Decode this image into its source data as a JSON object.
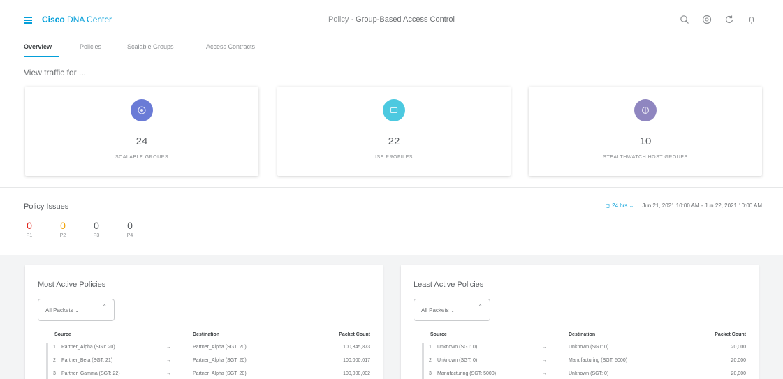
{
  "header": {
    "brand_bold": "Cisco",
    "brand_rest": "DNA Center",
    "title_prefix": "Policy · ",
    "title": "Group-Based Access Control"
  },
  "icons": [
    "menu-icon",
    "search-icon",
    "help-icon",
    "refresh-icon",
    "notification-icon"
  ],
  "tabs": [
    {
      "label": "Overview",
      "active": true
    },
    {
      "label": "Policies",
      "active": false
    },
    {
      "label": "Scalable Groups",
      "active": false
    },
    {
      "label": "Access Contracts",
      "active": false
    }
  ],
  "view_traffic": "View traffic for ...",
  "cards": [
    {
      "count": "24",
      "label": "SCALABLE GROUPS",
      "color": "#6a7bd6"
    },
    {
      "count": "22",
      "label": "ISE PROFILES",
      "color": "#4cc9e0"
    },
    {
      "count": "10",
      "label": "STEALTHWATCH HOST GROUPS",
      "color": "#8f86c0"
    }
  ],
  "policy_issues": {
    "title": "Policy Issues",
    "items": [
      {
        "value": "0",
        "label": "P1",
        "color": "#e2231a"
      },
      {
        "value": "0",
        "label": "P2",
        "color": "#f0a30a"
      },
      {
        "value": "0",
        "label": "P3",
        "color": "#5a5e62"
      },
      {
        "value": "0",
        "label": "P4",
        "color": "#5a5e62"
      }
    ]
  },
  "time_range": {
    "selector": "24 hrs",
    "range": "Jun 21, 2021 10:00 AM - Jun 22, 2021 10:00 AM"
  },
  "most_active": {
    "title": "Most Active Policies",
    "dropdown": "All Packets",
    "columns": {
      "source": "Source",
      "destination": "Destination",
      "count": "Packet Count"
    },
    "rows": [
      {
        "idx": "1",
        "source": "Partner_Alpha (SGT: 20)",
        "destination": "Partner_Alpha (SGT: 20)",
        "count": "100,345,873"
      },
      {
        "idx": "2",
        "source": "Partner_Beta (SGT: 21)",
        "destination": "Partner_Alpha (SGT: 20)",
        "count": "100,000,017"
      },
      {
        "idx": "3",
        "source": "Partner_Gamma (SGT: 22)",
        "destination": "Partner_Alpha (SGT: 20)",
        "count": "100,000,002"
      }
    ]
  },
  "least_active": {
    "title": "Least Active Policies",
    "dropdown": "All Packets",
    "columns": {
      "source": "Source",
      "destination": "Destination",
      "count": "Packet Count"
    },
    "rows": [
      {
        "idx": "1",
        "source": "Unknown (SGT: 0)",
        "destination": "Unknown (SGT: 0)",
        "count": "20,000"
      },
      {
        "idx": "2",
        "source": "Unknown (SGT: 0)",
        "destination": "Manufacturing (SGT: 5000)",
        "count": "20,000"
      },
      {
        "idx": "3",
        "source": "Manufacturing (SGT: 5000)",
        "destination": "Unknown (SGT: 0)",
        "count": "20,000"
      }
    ]
  }
}
